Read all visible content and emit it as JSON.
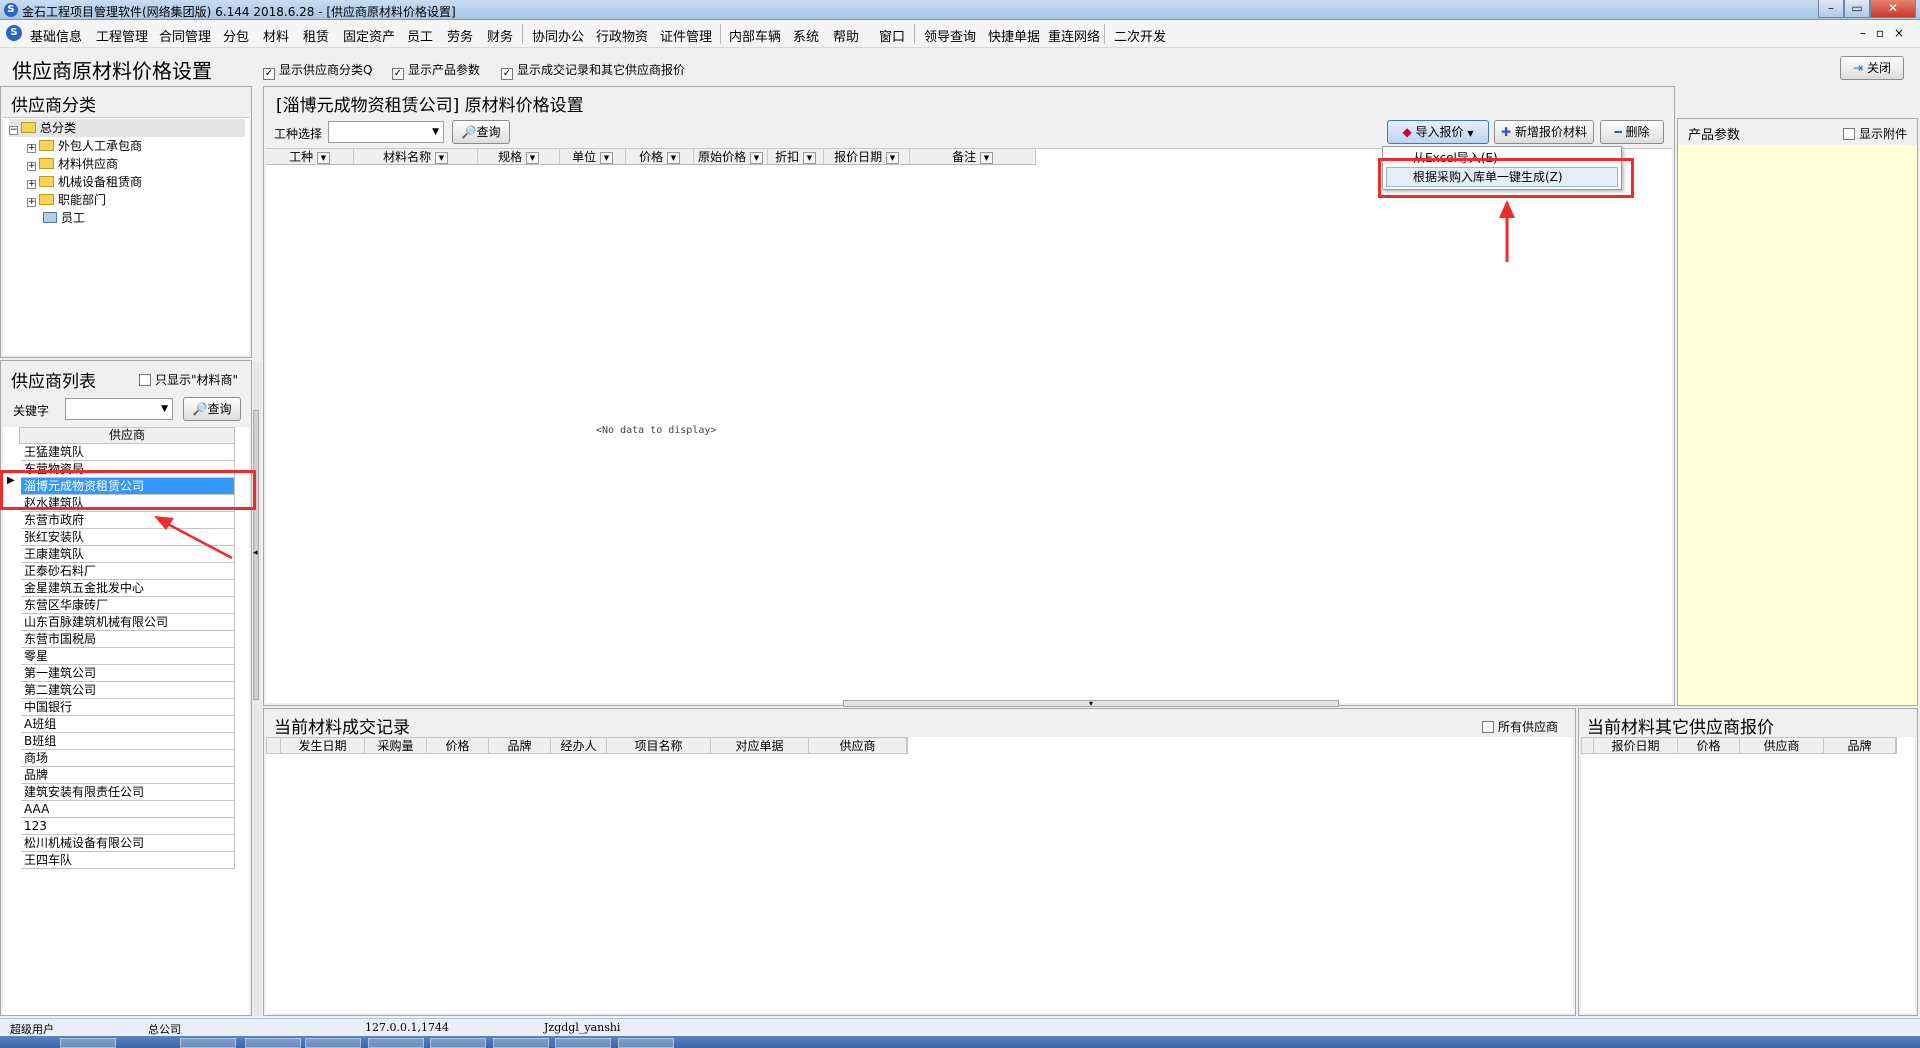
{
  "window": {
    "title": "金石工程项目管理软件(网络集团版) 6.144  2018.6.28 - [供应商原材料价格设置]",
    "icon": "app-logo-icon",
    "controls": [
      "minimize",
      "maximize",
      "close"
    ]
  },
  "menu": {
    "items": [
      "基础信息",
      "工程管理",
      "合同管理",
      "分包",
      "材料",
      "租赁",
      "固定资产",
      "员工",
      "劳务",
      "财务",
      "协同办公",
      "行政物资",
      "证件管理",
      "内部车辆",
      "系统",
      "帮助",
      "窗口",
      "领导查询",
      "快捷单据",
      "重连网络",
      "二次开发"
    ]
  },
  "header": {
    "title": "供应商原材料价格设置",
    "options": [
      {
        "label": "显示供应商分类Q",
        "checked": true
      },
      {
        "label": "显示产品参数",
        "checked": true
      },
      {
        "label": "显示成交记录和其它供应商报价",
        "checked": true
      }
    ],
    "close_label": "关闭"
  },
  "category_panel": {
    "title": "供应商分类",
    "tree": [
      {
        "label": "总分类",
        "level": 0,
        "expanded": true
      },
      {
        "label": "外包人工承包商",
        "level": 1
      },
      {
        "label": "材料供应商",
        "level": 1
      },
      {
        "label": "机械设备租赁商",
        "level": 1
      },
      {
        "label": "职能部门",
        "level": 1
      },
      {
        "label": "员工",
        "level": 1
      }
    ]
  },
  "supplier_panel": {
    "title": "供应商列表",
    "only_material_label": "只显示\"材料商\"",
    "keyword_label": "关键字",
    "query_label": "查询",
    "column": "供应商",
    "selected_index": 2,
    "rows": [
      "王猛建筑队",
      "东营物资局",
      "淄博元成物资租赁公司",
      "赵水建筑队",
      "东营市政府",
      "张红安装队",
      "王康建筑队",
      "正泰砂石料厂",
      "金星建筑五金批发中心",
      "东营区华康砖厂",
      "山东百脉建筑机械有限公司",
      "东营市国税局",
      "零星",
      "第一建筑公司",
      "第二建筑公司",
      "中国银行",
      "A班组",
      "B班组",
      "商场",
      "品牌",
      "建筑安装有限责任公司",
      "AAA",
      "123",
      "松川机械设备有限公司",
      "王四车队"
    ]
  },
  "main_panel": {
    "title": "[淄博元成物资租赁公司] 原材料价格设置",
    "work_type_label": "工种选择",
    "query_label": "查询",
    "import_label": "导入报价",
    "add_label": "新增报价材料",
    "delete_label": "删除",
    "columns": [
      "工种",
      "材料名称",
      "规格",
      "单位",
      "价格",
      "原始价格",
      "折扣",
      "报价日期",
      "备注"
    ],
    "empty_text": "<No data to display>",
    "import_menu": [
      "从Excel导入(E)",
      "根据采购入库单一键生成(Z)"
    ]
  },
  "params_panel": {
    "title": "产品参数",
    "show_attach_label": "显示附件"
  },
  "records_panel": {
    "title": "当前材料成交记录",
    "all_suppliers_label": "所有供应商",
    "columns": [
      "发生日期",
      "采购量",
      "价格",
      "品牌",
      "经办人",
      "项目名称",
      "对应单据",
      "供应商"
    ]
  },
  "others_panel": {
    "title": "当前材料其它供应商报价",
    "columns": [
      "报价日期",
      "价格",
      "供应商",
      "品牌"
    ]
  },
  "status": {
    "user": "超级用户",
    "org": "总公司",
    "server": "127.0.0.1,1744",
    "db": "Jzgdgl_yanshi"
  },
  "colors": {
    "selection": "#3399ff",
    "annotation": "#ef2b2b",
    "params_bg": "#ffffd8"
  }
}
